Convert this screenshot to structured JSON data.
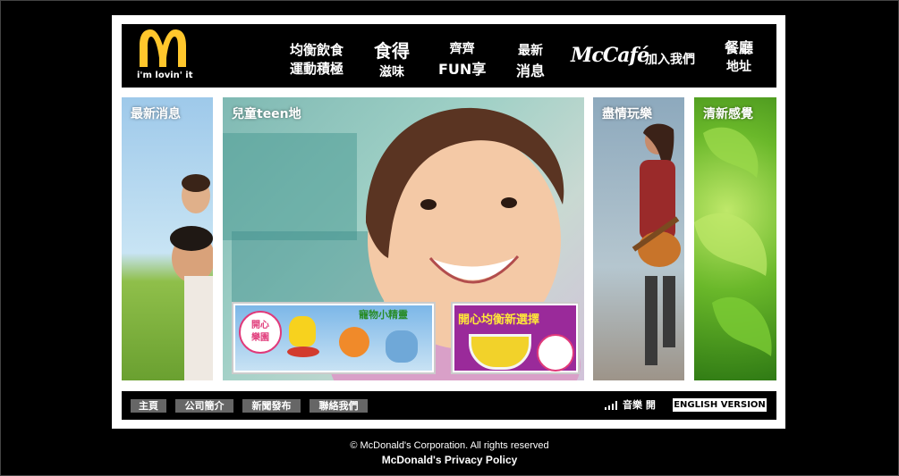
{
  "brand": {
    "tagline": "i'm lovin' it"
  },
  "nav": [
    {
      "l1": "均衡飲食",
      "l2": "運動積極"
    },
    {
      "l1": "食得",
      "l2": "滋味"
    },
    {
      "l1": "齊齊",
      "l2": "FUN享"
    },
    {
      "l1": "最新",
      "l2": "消息"
    },
    {
      "mccafe": "McCafé"
    },
    {
      "l1": "加入我們"
    },
    {
      "l1": "餐廳",
      "l2": "地址"
    }
  ],
  "panels": [
    {
      "title": "最新消息"
    },
    {
      "title": "兒童teen地"
    },
    {
      "title": "盡情玩樂"
    },
    {
      "title": "清新感覺"
    }
  ],
  "promos": {
    "left_badge_line1": "開心",
    "left_badge_line2": "樂園",
    "left_title": "寵物小精靈",
    "right_title": "開心均衡新選擇"
  },
  "footer": {
    "links": [
      "主頁",
      "公司簡介",
      "新聞發布",
      "聯絡我們"
    ],
    "music_label": "音樂 開",
    "english": "ENGLISH VERSION"
  },
  "legal": {
    "copyright": "© McDonald's Corporation. All rights reserved",
    "privacy": "McDonald's Privacy Policy"
  },
  "colors": {
    "brand_yellow": "#FFC72C",
    "button_grey": "#666666"
  }
}
